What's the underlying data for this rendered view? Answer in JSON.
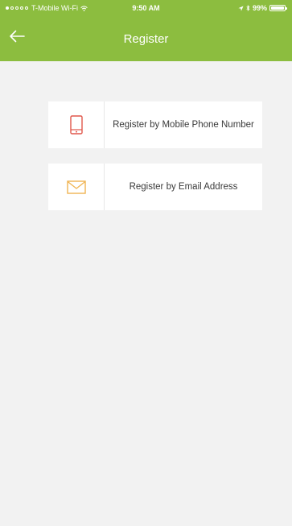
{
  "status_bar": {
    "carrier": "T-Mobile Wi-Fi",
    "time": "9:50 AM",
    "battery": "99%"
  },
  "header": {
    "title": "Register"
  },
  "options": [
    {
      "label": "Register by Mobile Phone Number",
      "icon": "mobile-phone-icon"
    },
    {
      "label": "Register by Email Address",
      "icon": "envelope-icon"
    }
  ],
  "colors": {
    "header_bg": "#8cbd3f",
    "background": "#f2f2f2",
    "phone_icon": "#e0574b",
    "email_icon": "#f0b452"
  }
}
